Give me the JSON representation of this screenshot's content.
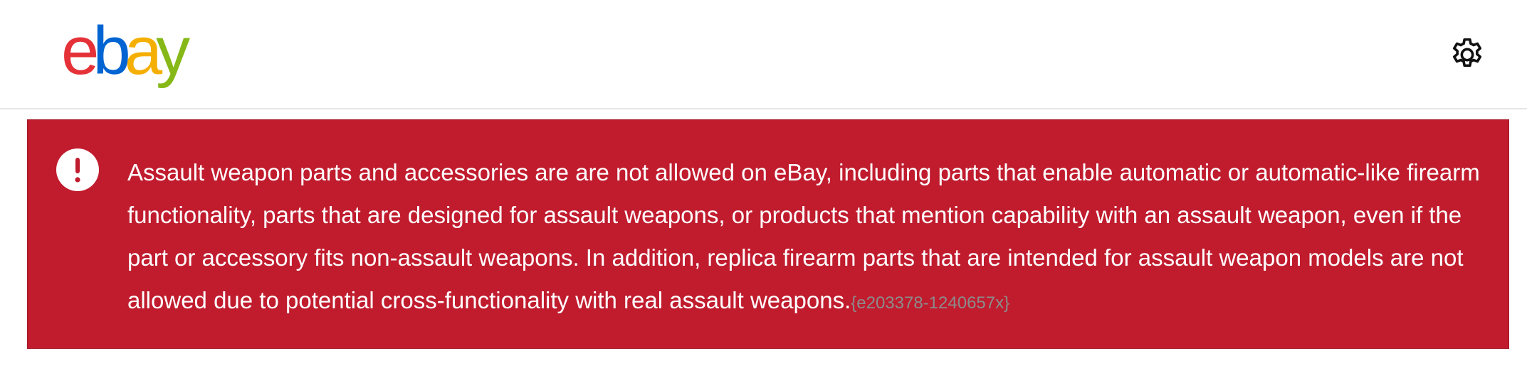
{
  "header": {
    "logo": {
      "letters": [
        "e",
        "b",
        "a",
        "y"
      ],
      "colors": [
        "#e53238",
        "#0064d2",
        "#f5af02",
        "#86b817"
      ]
    },
    "settings_icon": "gear-icon"
  },
  "alert": {
    "icon": "exclamation-circle-icon",
    "background": "#c01c2e",
    "message": "Assault weapon parts and accessories are are not allowed on eBay, including parts that enable automatic or automatic-like firearm functionality, parts that are designed for assault weapons, or products that mention capability with an assault weapon, even if the part or accessory fits non-assault weapons. In addition, replica firearm parts that are intended for assault weapon models are not allowed due to potential cross-functionality with real assault weapons.",
    "code": "{e203378-1240657x}"
  }
}
